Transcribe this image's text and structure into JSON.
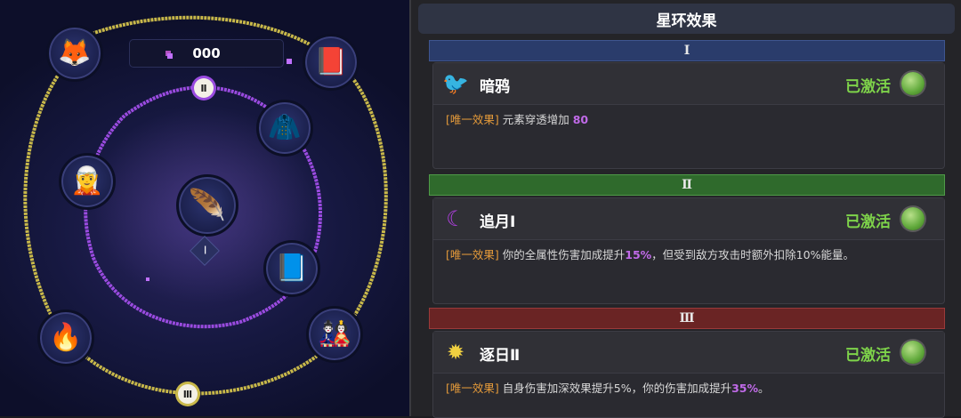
{
  "map": {
    "counter": "000",
    "ring_tags": {
      "ii": "Ⅱ",
      "iii": "Ⅲ"
    },
    "center_label": "Ⅰ",
    "nodes": [
      {
        "name": "fox-character-icon",
        "glyph": "🦊"
      },
      {
        "name": "spellbook-icon",
        "glyph": "📕"
      },
      {
        "name": "purple-robe-icon",
        "glyph": "🧥"
      },
      {
        "name": "green-hair-character-icon",
        "glyph": "🧝"
      },
      {
        "name": "crow-feather-icon",
        "glyph": "🪶"
      },
      {
        "name": "dark-tome-icon",
        "glyph": "📘"
      },
      {
        "name": "fire-sword-icon",
        "glyph": "🔥"
      },
      {
        "name": "shrine-maiden-icon",
        "glyph": "🎎"
      }
    ],
    "colors": {
      "outer_ring": "#c8b84a",
      "inner_ring": "#9a4be0"
    }
  },
  "panel": {
    "title": "星环效果",
    "tiers": [
      {
        "roman": "Ⅰ",
        "name": "暗鸦",
        "icon": "crow-icon",
        "status": "已激活",
        "tag": "[唯一效果]",
        "text_a": " 元素穿透增加 ",
        "hl_a": "80",
        "text_b": "",
        "hl_b": "",
        "text_c": ""
      },
      {
        "roman": "Ⅱ",
        "name": "追月Ⅰ",
        "icon": "crescent-moon-icon",
        "status": "已激活",
        "tag": "[唯一效果]",
        "text_a": " 你的全属性伤害加成提升",
        "hl_a": "15%",
        "text_b": "，但受到敌方攻击时额外扣除10%能量。",
        "hl_b": "",
        "text_c": ""
      },
      {
        "roman": "Ⅲ",
        "name": "逐日Ⅱ",
        "icon": "sun-icon",
        "status": "已激活",
        "tag": "[唯一效果]",
        "text_a": " 自身伤害加深效果提升5%，你的伤害加成提升",
        "hl_a": "35%",
        "text_b": "。",
        "hl_b": "",
        "text_c": ""
      }
    ],
    "colors": {
      "active": "#7ed34a",
      "tag": "#e49a3a",
      "highlight": "#c06ae8"
    }
  }
}
